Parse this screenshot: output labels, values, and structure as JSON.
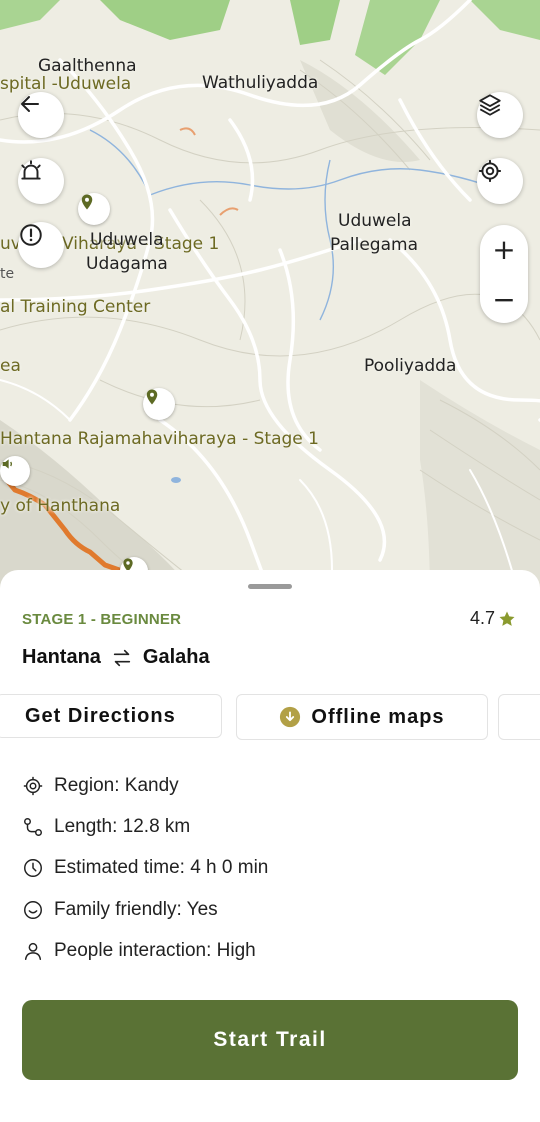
{
  "map": {
    "labels": {
      "gaalthenna": "Gaalthenna",
      "hospital": "spital -Uduwela",
      "wathuliyadda": "Wathuliyadda",
      "uduwela_pallegama_1": "Uduwela",
      "uduwela_pallegama_2": "Pallegama",
      "viharaya_stage": "Viharaya - Stage 1",
      "uduwela_udagama_1": "Uduwela",
      "uduwela_udagama_2": "Udagama",
      "uv": "uv",
      "te": "te",
      "training_center": "al Training Center",
      "ea": "ea",
      "pooliyadda": "Pooliyadda",
      "hantana_rajamaha": "Hantana Rajamahaviharaya - Stage 1",
      "of_hanthana": "y of Hanthana"
    },
    "icons": {
      "back": "arrow-left-icon",
      "alert": "bell-icon",
      "report": "exclamation-circle-icon",
      "layers": "layers-icon",
      "locate": "crosshair-icon",
      "zoom_in": "+",
      "zoom_out": "−"
    }
  },
  "sheet": {
    "stage_label": "STAGE 1 - BEGINNER",
    "rating": "4.7",
    "route_from": "Hantana",
    "route_to": "Galaha",
    "actions": {
      "directions": "Get Directions",
      "offline": "Offline maps"
    },
    "info": [
      {
        "icon": "region-icon",
        "text": "Region: Kandy"
      },
      {
        "icon": "length-icon",
        "text": "Length: 12.8 km"
      },
      {
        "icon": "clock-icon",
        "text": "Estimated time: 4 h 0 min"
      },
      {
        "icon": "smile-icon",
        "text": "Family friendly: Yes"
      },
      {
        "icon": "person-icon",
        "text": "People interaction: High"
      }
    ],
    "start_button": "Start Trail"
  },
  "colors": {
    "accent": "#5a7235",
    "stage": "#6a8a3f",
    "star": "#8a9a2e",
    "trail": "#e07a2e"
  }
}
